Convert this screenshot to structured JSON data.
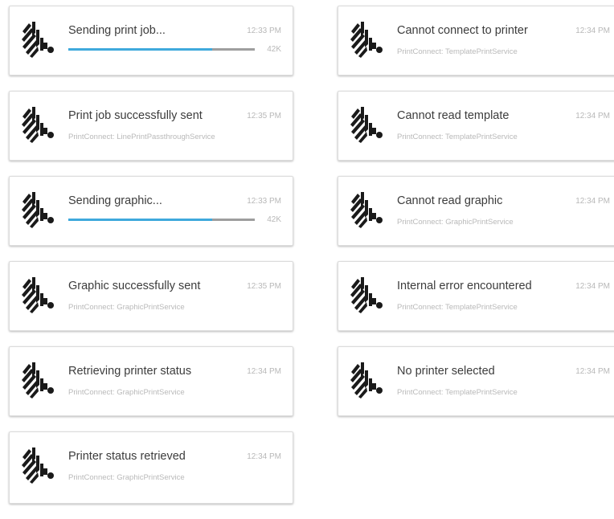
{
  "notifications_left": [
    {
      "title": "Sending print job...",
      "time": "12:33 PM",
      "progress": 0.77,
      "size": "42K"
    },
    {
      "title": "Print job successfully sent",
      "time": "12:35 PM",
      "subtitle": "PrintConnect: LinePrintPassthroughService"
    },
    {
      "title": "Sending graphic...",
      "time": "12:33 PM",
      "progress": 0.77,
      "size": "42K"
    },
    {
      "title": "Graphic successfully sent",
      "time": "12:35 PM",
      "subtitle": "PrintConnect: GraphicPrintService"
    },
    {
      "title": "Retrieving printer status",
      "time": "12:34 PM",
      "subtitle": "PrintConnect: GraphicPrintService"
    },
    {
      "title": "Printer status retrieved",
      "time": "12:34 PM",
      "subtitle": "PrintConnect: GraphicPrintService"
    }
  ],
  "notifications_right": [
    {
      "title": "Cannot connect to printer",
      "time": "12:34 PM",
      "subtitle": "PrintConnect: TemplatePrintService"
    },
    {
      "title": "Cannot read template",
      "time": "12:34 PM",
      "subtitle": "PrintConnect: TemplatePrintService"
    },
    {
      "title": "Cannot read graphic",
      "time": "12:34 PM",
      "subtitle": "PrintConnect: GraphicPrintService"
    },
    {
      "title": "Internal error encountered",
      "time": "12:34 PM",
      "subtitle": "PrintConnect: TemplatePrintService"
    },
    {
      "title": "No printer selected",
      "time": "12:34 PM",
      "subtitle": "PrintConnect: TemplatePrintService"
    }
  ],
  "colors": {
    "progress": "#3fa9dc",
    "track": "#9e9e9e",
    "logo": "#1a1a1a"
  },
  "icon": "zebra-logo-icon"
}
